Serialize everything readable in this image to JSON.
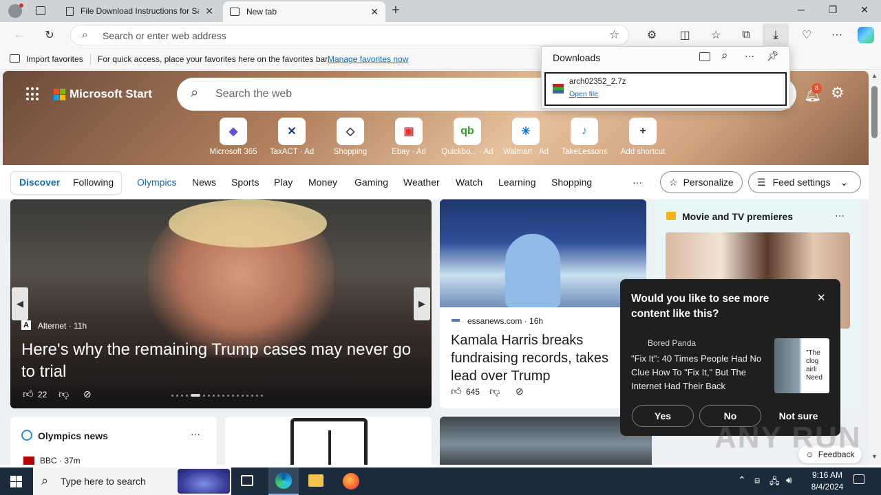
{
  "browser": {
    "tabs": [
      {
        "label": "File Download Instructions for Sa"
      },
      {
        "label": "New tab"
      }
    ],
    "address_placeholder": "Search or enter web address",
    "favbar": {
      "import_label": "Import favorites",
      "hint": "For quick access, place your favorites here on the favorites bar.",
      "manage_link": "Manage favorites now"
    }
  },
  "downloads": {
    "title": "Downloads",
    "file_name": "arch02352_2.7z",
    "open_link": "Open file"
  },
  "start": {
    "logo_text": "Microsoft Start",
    "search_placeholder": "Search the web",
    "notification_count": "8",
    "shortcuts": [
      {
        "label": "Microsoft 365",
        "icon": "m365-icon",
        "glyph": "◆",
        "color": "#6a4bd8"
      },
      {
        "label": "TaxACT · Ad",
        "icon": "taxact-icon",
        "glyph": "✕",
        "color": "#1a3d6e"
      },
      {
        "label": "Shopping",
        "icon": "tag-icon",
        "glyph": "◇",
        "color": "#333333"
      },
      {
        "label": "Ebay · Ad",
        "icon": "ebay-icon",
        "glyph": "▣",
        "color": "#e53238"
      },
      {
        "label": "Quickbo... · Ad",
        "icon": "quickbooks-icon",
        "glyph": "qb",
        "color": "#2ca01c"
      },
      {
        "label": "Walmart · Ad",
        "icon": "walmart-icon",
        "glyph": "✳",
        "color": "#0071ce"
      },
      {
        "label": "TakeLessons",
        "icon": "takelessons-icon",
        "glyph": "♪",
        "color": "#2a7fd0"
      },
      {
        "label": "Add shortcut",
        "icon": "plus-icon",
        "glyph": "+",
        "color": "#333333"
      }
    ],
    "nav": {
      "discover": "Discover",
      "following": "Following",
      "items": [
        "Olympics",
        "News",
        "Sports",
        "Play",
        "Money",
        "Gaming",
        "Weather",
        "Watch",
        "Learning",
        "Shopping"
      ],
      "more": "···",
      "personalize": "Personalize",
      "feed_settings": "Feed settings"
    },
    "hero_card": {
      "source": "Alternet · 11h",
      "headline": "Here's why the remaining Trump cases may never go to trial",
      "likes": "22"
    },
    "side_card": {
      "source": "essanews.com · 16h",
      "headline": "Kamala Harris breaks fundraising records, takes lead over Trump",
      "likes": "645"
    },
    "movie_card": {
      "title": "Movie and TV premieres"
    },
    "olympics_card": {
      "title": "Olympics news",
      "source": "BBC · 37m"
    },
    "feedback": "Feedback"
  },
  "popup": {
    "question": "Would you like to see more content like this?",
    "source": "Bored Panda",
    "headline": "\"Fix It\": 40 Times People Had No Clue How To \"Fix It,\" But The Internet Had Their Back",
    "thumb_text": "\"The clog airli Need",
    "yes": "Yes",
    "no": "No",
    "not_sure": "Not sure"
  },
  "taskbar": {
    "search_placeholder": "Type here to search",
    "time": "9:16 AM",
    "date": "8/4/2024"
  },
  "watermark": "ANY RUN",
  "colors": {
    "accent": "#0f6cbd",
    "olympics_link": "#0f6cbd",
    "popup_bg": "#1f1f1f",
    "taskbar_bg": "#1c2b3b"
  }
}
